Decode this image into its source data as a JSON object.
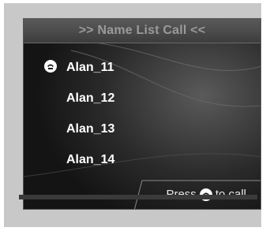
{
  "header": {
    "title": ">> Name List Call <<"
  },
  "list": {
    "items": [
      {
        "label": "Alan_11",
        "icon": "call-icon"
      },
      {
        "label": "Alan_12"
      },
      {
        "label": "Alan_13"
      },
      {
        "label": "Alan_14"
      }
    ]
  },
  "footer": {
    "hint_prefix": "Press",
    "hint_icon": "call-icon",
    "hint_suffix": "to call"
  },
  "colors": {
    "screen_bg": "#1a1a1a",
    "title_text": "#9a9a9a",
    "item_text": "#ffffff",
    "frame": "#c8c8c8"
  }
}
